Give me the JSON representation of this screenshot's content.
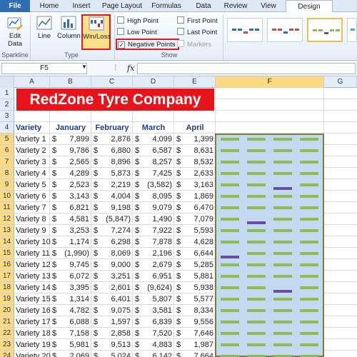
{
  "ribbon": {
    "tabs": [
      "File",
      "Home",
      "Insert",
      "Page Layout",
      "Formulas",
      "Data",
      "Review",
      "View",
      "Design"
    ],
    "active_tab": "Design",
    "edit_data_label": "Edit Data",
    "sparkline_group_label": "Sparkline",
    "type_group_label": "Type",
    "show_group_label": "Show",
    "type_buttons": [
      "Line",
      "Column",
      "Win/Loss"
    ],
    "selected_type": "Win/Loss",
    "show_options": [
      {
        "label": "High Point",
        "checked": false
      },
      {
        "label": "First Point",
        "checked": false
      },
      {
        "label": "Low Point",
        "checked": false
      },
      {
        "label": "Last Point",
        "checked": false
      },
      {
        "label": "Negative Points",
        "checked": true
      },
      {
        "label": "Markers",
        "checked": false
      }
    ],
    "colors": {
      "accent_red": "#e01b22",
      "win": "#8fbc4f",
      "loss": "#6a4f9f"
    }
  },
  "formula_bar": {
    "name_box": "F5",
    "fx": "fx",
    "formula": ""
  },
  "columns": [
    "A",
    "B",
    "C",
    "D",
    "E",
    "F",
    "G"
  ],
  "selected_column": "F",
  "sheet": {
    "title": "RedZone Tyre Company",
    "headers": [
      "Variety",
      "January",
      "February",
      "March",
      "April"
    ],
    "currency": "$",
    "rows": [
      {
        "name": "Variety 1",
        "jan": "7,899",
        "feb": "2,876",
        "mar": "4,099",
        "apr": "1,399",
        "wl": [
          1,
          1,
          1,
          1
        ]
      },
      {
        "name": "Variety 2",
        "jan": "9,786",
        "feb": "6,880",
        "mar": "6,587",
        "apr": "8,631",
        "wl": [
          1,
          1,
          1,
          1
        ]
      },
      {
        "name": "Variety 3",
        "jan": "2,565",
        "feb": "8,896",
        "mar": "8,257",
        "apr": "8,532",
        "wl": [
          1,
          1,
          1,
          1
        ]
      },
      {
        "name": "Variety 4",
        "jan": "4,289",
        "feb": "5,873",
        "mar": "7,425",
        "apr": "2,633",
        "wl": [
          1,
          1,
          1,
          1
        ]
      },
      {
        "name": "Variety 5",
        "jan": "2,523",
        "feb": "2,219",
        "mar": "(3,582)",
        "apr": "3,163",
        "wl": [
          1,
          1,
          -1,
          1
        ]
      },
      {
        "name": "Variety 6",
        "jan": "3,143",
        "feb": "4,004",
        "mar": "8,095",
        "apr": "1,869",
        "wl": [
          1,
          1,
          1,
          1
        ]
      },
      {
        "name": "Variety 7",
        "jan": "6,821",
        "feb": "9,198",
        "mar": "9,079",
        "apr": "6,470",
        "wl": [
          1,
          1,
          1,
          1
        ]
      },
      {
        "name": "Variety 8",
        "jan": "4,581",
        "feb": "(5,847)",
        "mar": "1,490",
        "apr": "7,079",
        "wl": [
          1,
          -1,
          1,
          1
        ]
      },
      {
        "name": "Variety 9",
        "jan": "3,253",
        "feb": "7,274",
        "mar": "7,922",
        "apr": "5,593",
        "wl": [
          1,
          1,
          1,
          1
        ]
      },
      {
        "name": "Variety 10",
        "jan": "1,174",
        "feb": "6,298",
        "mar": "7,878",
        "apr": "4,628",
        "wl": [
          1,
          1,
          1,
          1
        ]
      },
      {
        "name": "Variety 11",
        "jan": "(1,990)",
        "feb": "8,069",
        "mar": "2,196",
        "apr": "6,644",
        "wl": [
          -1,
          1,
          1,
          1
        ]
      },
      {
        "name": "Variety 12",
        "jan": "9,745",
        "feb": "9,000",
        "mar": "2,679",
        "apr": "5,285",
        "wl": [
          1,
          1,
          1,
          1
        ]
      },
      {
        "name": "Variety 13",
        "jan": "6,072",
        "feb": "3,251",
        "mar": "6,951",
        "apr": "5,881",
        "wl": [
          1,
          1,
          1,
          1
        ]
      },
      {
        "name": "Variety 14",
        "jan": "3,395",
        "feb": "2,601",
        "mar": "(9,624)",
        "apr": "5,938",
        "wl": [
          1,
          1,
          -1,
          1
        ]
      },
      {
        "name": "Variety 15",
        "jan": "1,314",
        "feb": "6,401",
        "mar": "5,807",
        "apr": "5,577",
        "wl": [
          1,
          1,
          1,
          1
        ]
      },
      {
        "name": "Variety 16",
        "jan": "4,782",
        "feb": "9,075",
        "mar": "3,581",
        "apr": "8,334",
        "wl": [
          1,
          1,
          1,
          1
        ]
      },
      {
        "name": "Variety 17",
        "jan": "6,088",
        "feb": "1,597",
        "mar": "6,839",
        "apr": "9,556",
        "wl": [
          1,
          1,
          1,
          1
        ]
      },
      {
        "name": "Variety 18",
        "jan": "7,158",
        "feb": "2,858",
        "mar": "7,520",
        "apr": "7,646",
        "wl": [
          1,
          1,
          1,
          1
        ]
      },
      {
        "name": "Variety 19",
        "jan": "5,981",
        "feb": "9,513",
        "mar": "4,883",
        "apr": "1,987",
        "wl": [
          1,
          1,
          1,
          1
        ]
      },
      {
        "name": "Variety 20",
        "jan": "2,069",
        "feb": "5,024",
        "mar": "6,142",
        "apr": "7,664",
        "wl": [
          1,
          1,
          1,
          1
        ]
      }
    ]
  },
  "row_numbers": [
    "1",
    "2",
    "3",
    "4",
    "5",
    "6",
    "7",
    "8",
    "9",
    "10",
    "11",
    "12",
    "13",
    "14",
    "15",
    "16",
    "17",
    "18",
    "19",
    "20",
    "21",
    "22",
    "23",
    "24"
  ]
}
